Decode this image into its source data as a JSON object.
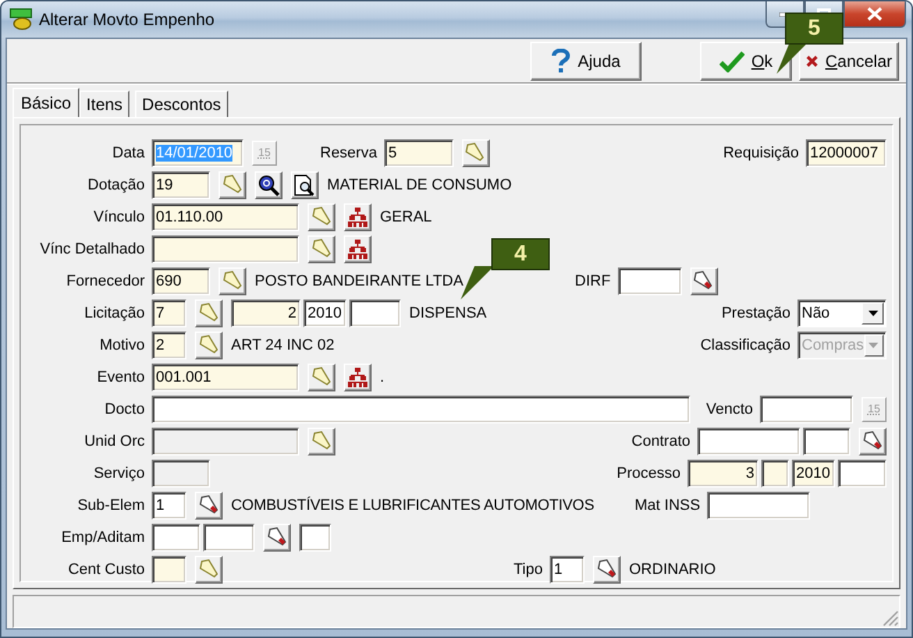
{
  "window": {
    "title": "Alterar Movto Empenho"
  },
  "toolbar": {
    "buttons": [
      {
        "kind": "help",
        "label": "Ajuda",
        "mnemonic": false
      },
      {
        "kind": "ok",
        "label": "Ok",
        "mnemonic": true
      },
      {
        "kind": "cancel",
        "label": "Cancelar",
        "mnemonic": true
      }
    ]
  },
  "tabs": [
    {
      "label": "Básico",
      "selected": true
    },
    {
      "label": "Itens",
      "selected": false
    },
    {
      "label": "Descontos",
      "selected": false
    }
  ],
  "form": {
    "rows": [
      {
        "left": [
          {
            "kind": "label",
            "text": "Data"
          },
          {
            "kind": "field",
            "value": "14/01/2010",
            "tinted": true,
            "disabled": false,
            "selected": true
          },
          {
            "kind": "calendar",
            "label": "15",
            "disabled": true
          }
        ],
        "middle": [
          {
            "kind": "label",
            "text": "Reserva"
          },
          {
            "kind": "field",
            "value": "5",
            "tinted": true,
            "disabled": false,
            "selected": false
          },
          {
            "kind": "lookup"
          }
        ],
        "right": [
          {
            "kind": "label",
            "text": "Requisição"
          },
          {
            "kind": "field",
            "value": "12000007",
            "tinted": true,
            "disabled": false,
            "selected": false
          }
        ]
      },
      {
        "left": [
          {
            "kind": "label",
            "text": "Dotação"
          },
          {
            "kind": "field",
            "value": "19",
            "tinted": true,
            "disabled": false,
            "selected": false
          },
          {
            "kind": "lookup"
          },
          {
            "kind": "search"
          },
          {
            "kind": "preview"
          },
          {
            "kind": "text",
            "text": "MATERIAL DE CONSUMO"
          }
        ]
      },
      {
        "left": [
          {
            "kind": "label",
            "text": "Vínculo"
          },
          {
            "kind": "field",
            "value": "01.110.00",
            "tinted": true,
            "disabled": false,
            "selected": false
          },
          {
            "kind": "lookup"
          },
          {
            "kind": "tree"
          },
          {
            "kind": "text",
            "text": "GERAL"
          }
        ]
      },
      {
        "left": [
          {
            "kind": "label",
            "text": "Vínc Detalhado"
          },
          {
            "kind": "field",
            "tinted": true,
            "disabled": false
          },
          {
            "kind": "lookup"
          },
          {
            "kind": "tree"
          }
        ]
      },
      {
        "left": [
          {
            "kind": "label",
            "text": "Fornecedor"
          },
          {
            "kind": "field",
            "value": "690",
            "tinted": true,
            "disabled": false,
            "selected": false
          },
          {
            "kind": "lookup"
          },
          {
            "kind": "text",
            "text": "POSTO BANDEIRANTE LTDA"
          }
        ],
        "middle": [
          {
            "kind": "label",
            "text": "DIRF"
          },
          {
            "kind": "field",
            "tinted": false,
            "disabled": false
          },
          {
            "kind": "picker"
          }
        ]
      },
      {
        "left": [
          {
            "kind": "label",
            "text": "Licitação"
          },
          {
            "kind": "field",
            "value": "7",
            "tinted": true,
            "disabled": false,
            "selected": false
          },
          {
            "kind": "lookup"
          },
          {
            "kind": "field",
            "value": "2",
            "tinted": true,
            "disabled": false,
            "selected": false
          },
          {
            "kind": "field",
            "value": "2010",
            "tinted": false,
            "disabled": false,
            "selected": false
          },
          {
            "kind": "field",
            "tinted": false,
            "disabled": false
          },
          {
            "kind": "text",
            "text": "DISPENSA"
          }
        ],
        "right": [
          {
            "kind": "label",
            "text": "Prestação"
          },
          {
            "kind": "select",
            "value": "Não",
            "disabled": false
          }
        ]
      },
      {
        "left": [
          {
            "kind": "label",
            "text": "Motivo"
          },
          {
            "kind": "field",
            "value": "2",
            "tinted": true,
            "disabled": false,
            "selected": false
          },
          {
            "kind": "lookup"
          },
          {
            "kind": "text",
            "text": "ART 24 INC 02"
          }
        ],
        "right": [
          {
            "kind": "label",
            "text": "Classificação"
          },
          {
            "kind": "select",
            "value": "Compras",
            "disabled": true
          }
        ]
      },
      {
        "left": [
          {
            "kind": "label",
            "text": "Evento"
          },
          {
            "kind": "field",
            "value": "001.001",
            "tinted": true,
            "disabled": false,
            "selected": false
          },
          {
            "kind": "lookup"
          },
          {
            "kind": "tree"
          },
          {
            "kind": "text",
            "text": "."
          }
        ]
      },
      {
        "left": [
          {
            "kind": "label",
            "text": "Docto"
          },
          {
            "kind": "field",
            "tinted": false,
            "disabled": false
          }
        ],
        "right": [
          {
            "kind": "label",
            "text": "Vencto"
          },
          {
            "kind": "field",
            "tinted": false,
            "disabled": false
          },
          {
            "kind": "calendar",
            "label": "15",
            "disabled": true
          }
        ]
      },
      {
        "left": [
          {
            "kind": "label",
            "text": "Unid Orc"
          },
          {
            "kind": "field",
            "disabled": true
          },
          {
            "kind": "lookup"
          }
        ],
        "right": [
          {
            "kind": "label",
            "text": "Contrato"
          },
          {
            "kind": "field",
            "tinted": false,
            "disabled": false
          },
          {
            "kind": "field",
            "tinted": false,
            "disabled": false
          },
          {
            "kind": "picker"
          }
        ]
      },
      {
        "left": [
          {
            "kind": "label",
            "text": "Serviço"
          },
          {
            "kind": "field",
            "disabled": true
          }
        ],
        "right": [
          {
            "kind": "label",
            "text": "Processo"
          },
          {
            "kind": "field",
            "value": "3",
            "tinted": true,
            "disabled": false,
            "selected": false
          },
          {
            "kind": "field",
            "tinted": true,
            "disabled": false
          },
          {
            "kind": "field",
            "value": "2010",
            "tinted": true,
            "disabled": false,
            "selected": false
          },
          {
            "kind": "field",
            "tinted": false,
            "disabled": false
          }
        ]
      },
      {
        "left": [
          {
            "kind": "label",
            "text": "Sub-Elem"
          },
          {
            "kind": "field",
            "value": "1",
            "tinted": false,
            "disabled": false,
            "selected": false
          },
          {
            "kind": "picker"
          },
          {
            "kind": "text",
            "text": "COMBUSTÍVEIS E LUBRIFICANTES AUTOMOTIVOS"
          }
        ],
        "middle": [
          {
            "kind": "label",
            "text": "Mat INSS"
          },
          {
            "kind": "field",
            "tinted": false,
            "disabled": false
          }
        ]
      },
      {
        "left": [
          {
            "kind": "label",
            "text": "Emp/Aditam"
          },
          {
            "kind": "field",
            "tinted": false,
            "disabled": false
          },
          {
            "kind": "field",
            "tinted": false,
            "disabled": false
          },
          {
            "kind": "picker"
          },
          {
            "kind": "field",
            "tinted": false,
            "disabled": false
          }
        ]
      },
      {
        "left": [
          {
            "kind": "label",
            "text": "Cent Custo"
          },
          {
            "kind": "field",
            "tinted": true,
            "disabled": false
          },
          {
            "kind": "lookup"
          }
        ],
        "middle": [
          {
            "kind": "label",
            "text": "Tipo"
          },
          {
            "kind": "field",
            "value": "1",
            "tinted": false,
            "disabled": false,
            "selected": false
          },
          {
            "kind": "picker"
          },
          {
            "kind": "text",
            "text": "ORDINARIO"
          }
        ]
      }
    ]
  },
  "callouts": [
    {
      "label": "5"
    },
    {
      "label": "4"
    }
  ]
}
